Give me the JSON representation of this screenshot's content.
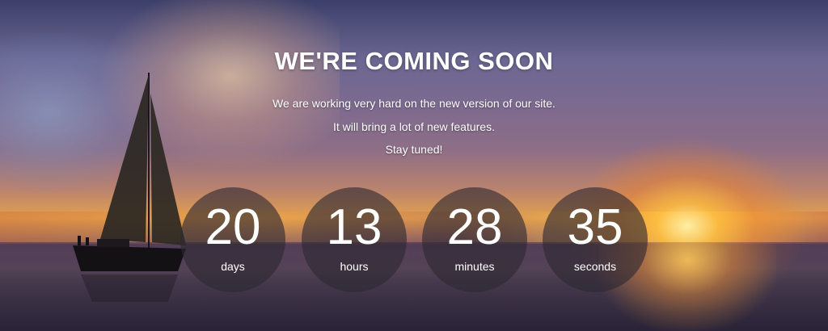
{
  "hero": {
    "title": "WE'RE COMING SOON",
    "lines": [
      "We are working very hard on the new version of our site.",
      "It will bring a lot of new features.",
      "Stay tuned!"
    ]
  },
  "countdown": [
    {
      "value": "20",
      "unit": "days"
    },
    {
      "value": "13",
      "unit": "hours"
    },
    {
      "value": "28",
      "unit": "minutes"
    },
    {
      "value": "35",
      "unit": "seconds"
    }
  ],
  "colors": {
    "text": "#ffffff",
    "circle": "#2d2832",
    "sun": "#ffbe3c"
  }
}
